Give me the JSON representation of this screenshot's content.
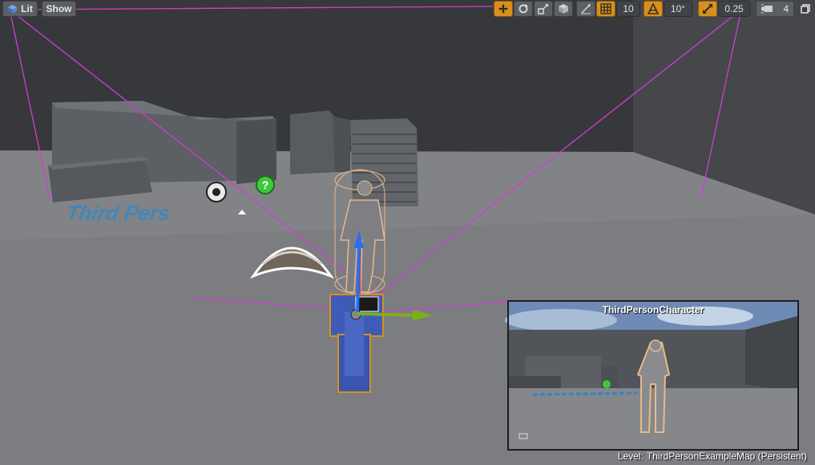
{
  "toolbar": {
    "lit_label": "Lit",
    "show_label": "Show",
    "grid_snap_value": "10",
    "rotation_snap_value": "10°",
    "scale_snap_value": "0.25",
    "camera_speed_value": "4",
    "icons": [
      "view-mode-icon",
      "translate-icon",
      "rotate-icon",
      "scale-icon",
      "world-local-icon",
      "surface-snap-icon",
      "grid-snap-icon",
      "rotation-snap-icon",
      "scale-snap-icon",
      "camera-speed-icon",
      "maximize-icon"
    ]
  },
  "scene": {
    "floor_text": "Third Pers",
    "colors": {
      "sky": "#2f3135",
      "floor": "#7c7e82",
      "block": "#55585c",
      "selection": "#d9901a",
      "frustum": "#d63ad6",
      "floor_text": "#2e87c9"
    }
  },
  "preview": {
    "title": "ThirdPersonCharacter"
  },
  "status": {
    "level_label": "Level:",
    "level_name": "ThirdPersonExampleMap (Persistent)"
  }
}
